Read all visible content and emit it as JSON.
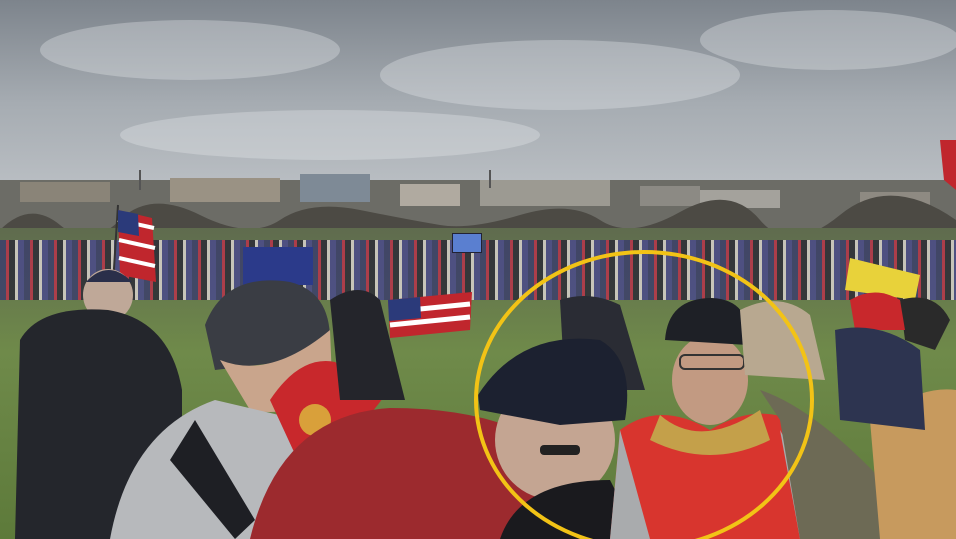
{
  "scene": {
    "kind": "photo",
    "palette": {
      "sky": "#a6acb2",
      "grass": "#6f8a4a",
      "highlight_ring": "#f2c316",
      "jacket_red": "#d8352e",
      "flag_red": "#c0262d",
      "flag_blue": "#2b3a7a"
    }
  }
}
